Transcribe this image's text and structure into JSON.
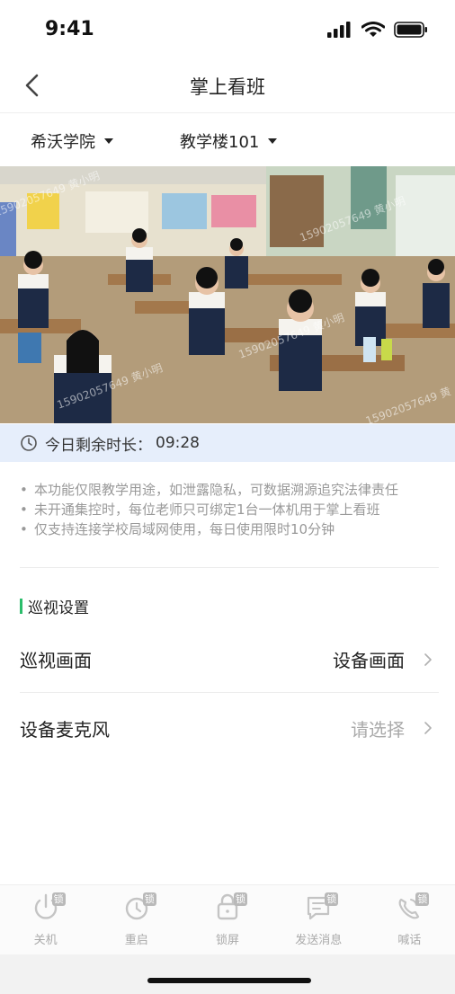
{
  "status_bar": {
    "time": "9:41"
  },
  "nav": {
    "title": "掌上看班"
  },
  "selectors": {
    "school": "希沃学院",
    "room": "教学楼101"
  },
  "video": {
    "watermarks": [
      "15902057649 黄小明",
      "15902057649 黄小明",
      "15902057649 黄小明",
      "15902057649 黄小明",
      "15902057649 黄"
    ]
  },
  "timer": {
    "label": "今日剩余时长：",
    "value": "09:28"
  },
  "notes": [
    "本功能仅限教学用途，如泄露隐私，可数据溯源追究法律责任",
    "未开通集控时，每位老师只可绑定1台一体机用于掌上看班",
    "仅支持连接学校局域网使用，每日使用限时10分钟"
  ],
  "patrol": {
    "section_title": "巡视设置",
    "rows": [
      {
        "label": "巡视画面",
        "value": "设备画面"
      },
      {
        "label": "设备麦克风",
        "value": "请选择"
      }
    ]
  },
  "toolbar": {
    "lock_badge": "锁",
    "items": [
      {
        "icon": "power-icon",
        "label": "关机"
      },
      {
        "icon": "restart-icon",
        "label": "重启"
      },
      {
        "icon": "lock-screen-icon",
        "label": "锁屏"
      },
      {
        "icon": "message-icon",
        "label": "发送消息"
      },
      {
        "icon": "call-icon",
        "label": "喊话"
      }
    ]
  },
  "colors": {
    "accent": "#2bbd6b",
    "timer_bg": "#e6eefb",
    "muted": "#aaaaaa"
  }
}
